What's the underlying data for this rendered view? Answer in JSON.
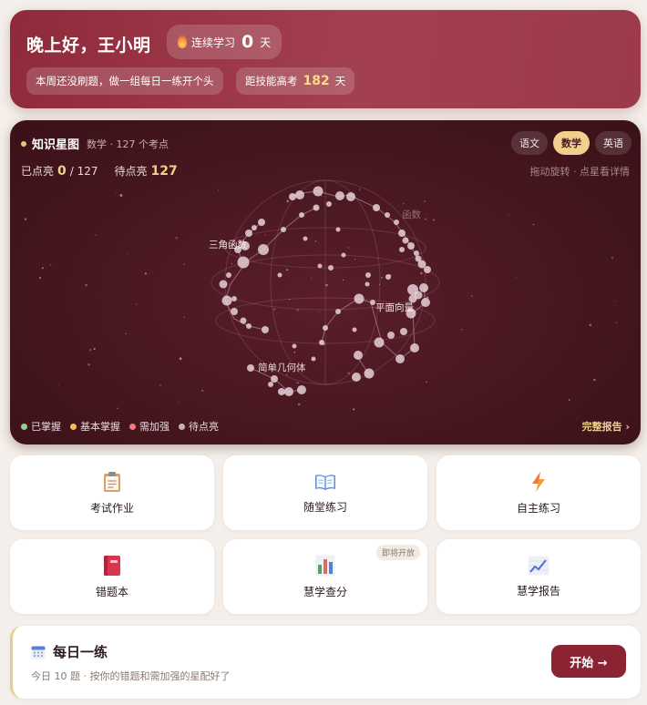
{
  "header": {
    "greeting": "晚上好，王小明",
    "streak_label": "连续学习",
    "streak_days": "0",
    "streak_unit": "天",
    "weekly_prompt": "本周还没刷题，做一组每日一练开个头",
    "countdown_label": "距技能高考",
    "countdown_days": "182",
    "countdown_unit": "天"
  },
  "star_map": {
    "title": "知识星图",
    "subtitle": "数学 · 127 个考点",
    "subjects": [
      {
        "label": "语文",
        "active": false
      },
      {
        "label": "数学",
        "active": true
      },
      {
        "label": "英语",
        "active": false
      }
    ],
    "lit_label": "已点亮",
    "lit_count": "0",
    "lit_total": "/ 127",
    "pending_label": "待点亮",
    "pending_count": "127",
    "hint": "拖动旋转 · 点星看详情",
    "cluster_labels": {
      "functions": "函数",
      "trig": "三角函数",
      "vectors": "平面向量",
      "geometry": "简单几何体"
    },
    "legend": [
      {
        "label": "已掌握",
        "color": "#8fd28a"
      },
      {
        "label": "基本掌握",
        "color": "#f2c24e"
      },
      {
        "label": "需加强",
        "color": "#ef7b7b"
      },
      {
        "label": "待点亮",
        "color": "#c8b4b8"
      }
    ],
    "report_link": "完整报告 ›"
  },
  "tiles": [
    {
      "label": "考试作业",
      "icon": "clipboard-icon"
    },
    {
      "label": "随堂练习",
      "icon": "open-book-icon"
    },
    {
      "label": "自主练习",
      "icon": "lightning-icon"
    },
    {
      "label": "错题本",
      "icon": "red-notebook-icon"
    },
    {
      "label": "慧学查分",
      "icon": "bar-chart-icon",
      "badge": "即将开放"
    },
    {
      "label": "慧学报告",
      "icon": "trend-chart-icon"
    }
  ],
  "daily": {
    "title": "每日一练",
    "icon": "calendar-icon",
    "description": "今日 10 题 · 按你的错题和需加强的星配好了",
    "button": "开始 →"
  }
}
